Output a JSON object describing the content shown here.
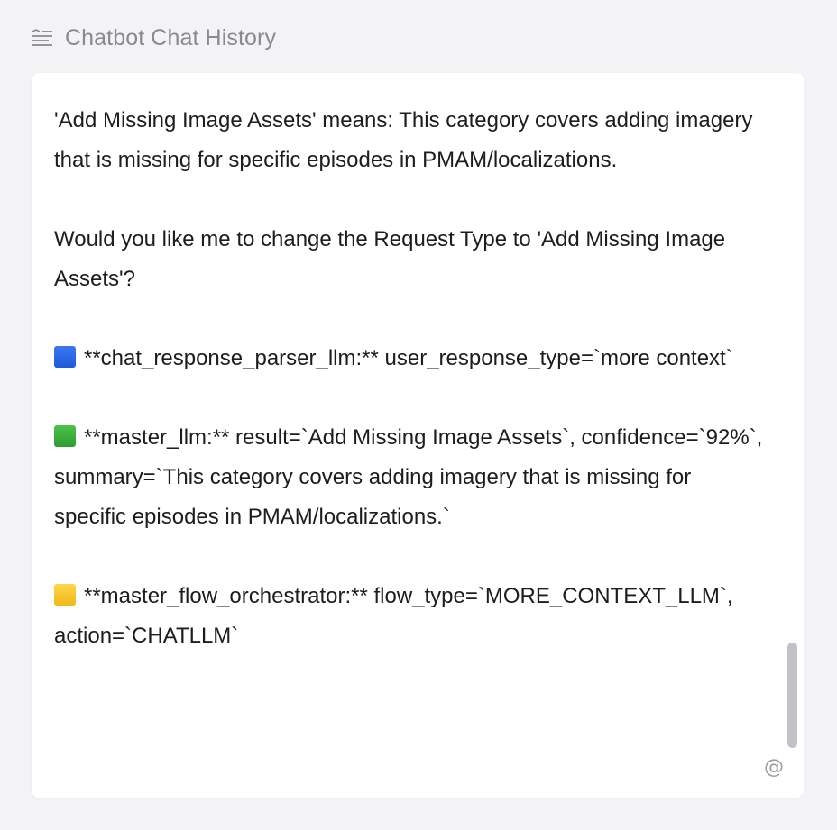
{
  "header": {
    "icon": "notes-list-icon",
    "title": "Chatbot Chat History"
  },
  "messages": {
    "p1": "'Add Missing Image Assets' means: This category covers adding imagery that is missing for specific episodes in PMAM/localizations.",
    "p2": "Would you like me to change the Request Type to 'Add Missing Image Assets'?",
    "p3": "**chat_response_parser_llm:** user_response_type=`more context`",
    "p4": "**master_llm:** result=`Add Missing Image Assets`, confidence=`92%`, summary=`This category covers adding imagery that is missing for specific episodes in PMAM/localizations.`",
    "p5": "**master_flow_orchestrator:** flow_type=`MORE_CONTEXT_LLM`, action=`CHATLLM`"
  },
  "colors": {
    "blue_square": "#2563eb",
    "green_square": "#3aa83c",
    "yellow_square": "#f5c22b"
  },
  "footer": {
    "mention_icon": "at-icon",
    "mention_glyph": "@"
  }
}
